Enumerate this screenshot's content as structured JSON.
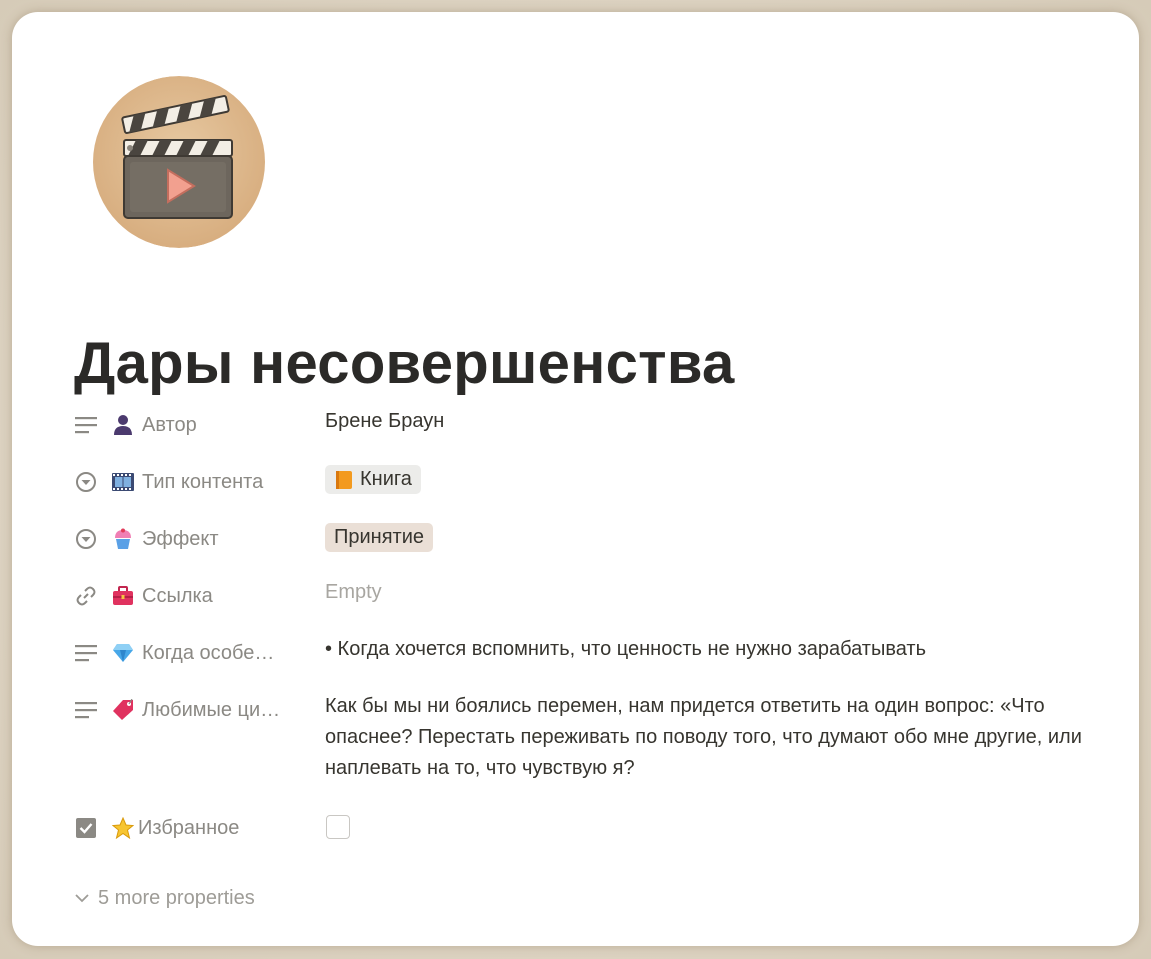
{
  "page": {
    "title": "Дары несовершенства"
  },
  "cover": {
    "icon": "clapperboard-icon"
  },
  "properties": [
    {
      "type_icon": "text-lines-icon",
      "emoji": "person-icon",
      "name": "Автор",
      "value": "Брене Браун"
    },
    {
      "type_icon": "select-icon",
      "emoji": "film-frames-icon",
      "name": "Тип контента",
      "tag_emoji": "orange-book-icon",
      "tag": "Книга"
    },
    {
      "type_icon": "select-icon",
      "emoji": "cupcake-icon",
      "name": "Эффект",
      "tag": "Принятие"
    },
    {
      "type_icon": "link-icon",
      "emoji": "briefcase-icon",
      "name": "Ссылка",
      "value": "Empty"
    },
    {
      "type_icon": "text-lines-icon",
      "emoji": "gem-icon",
      "name": "Когда особе…",
      "value": "• Когда хочется вспомнить, что ценность не нужно зарабатывать"
    },
    {
      "type_icon": "text-lines-icon",
      "emoji": "label-tag-icon",
      "name": "Любимые ци…",
      "value": "Как бы мы ни боялись перемен, нам придется ответить на один вопрос: «Что опаснее? Перестать переживать по поводу того, что думают обо мне другие, или наплевать на то, что чувствую я?"
    },
    {
      "type_icon": "checkbox-type-icon",
      "emoji": "star-icon",
      "name": "Избранное",
      "checked": false
    }
  ],
  "more_properties": "5 more properties",
  "colors": {
    "tag_book_bg": "#ececea",
    "tag_accept_bg": "#eadfd6",
    "text": "#37352f",
    "muted": "#8b8984"
  }
}
